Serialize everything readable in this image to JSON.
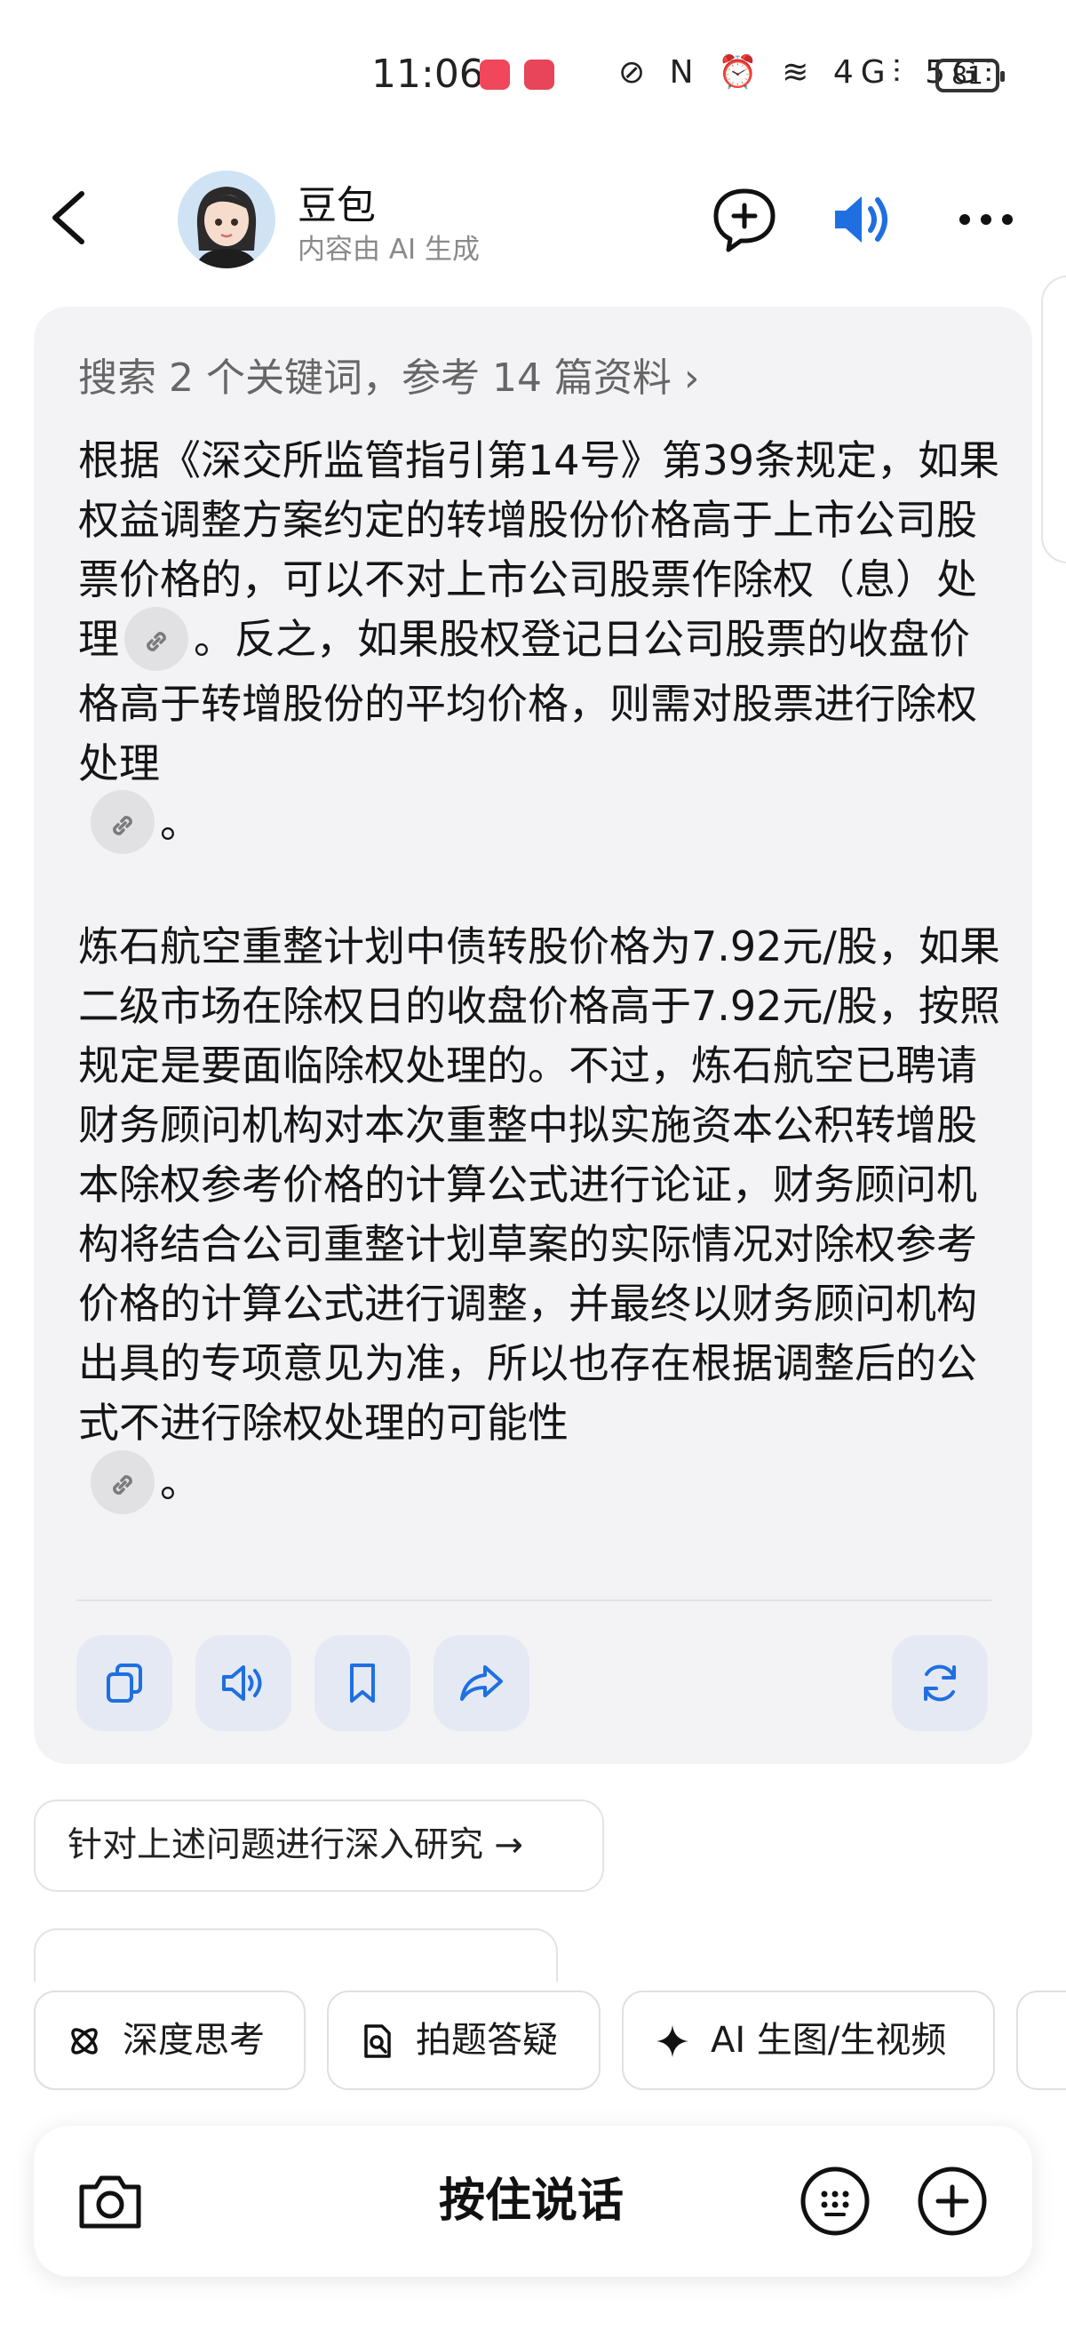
{
  "status": {
    "time": "11:06",
    "network_icons": [
      "speed-icon",
      "nfc-icon",
      "alarm-icon",
      "wifi-icon",
      "4g-signal-icon",
      "5g-signal-icon"
    ],
    "network_text": "⊘ N ⏰ ≋ 4G⫶ 5G⫶",
    "battery": "81"
  },
  "header": {
    "name": "豆包",
    "subtitle": "内容由 AI 生成"
  },
  "card": {
    "search_summary": "搜索 2 个关键词，参考 14 篇资料 ›",
    "para1_a": "根据《深交所监管指引第14号》第39条规定，如果权益调整方案约定的转增股份价格高于上市公司股票价格的，可以不对上市公司股票作除权（息）处理",
    "para1_b": "。反之，如果股权登记日公司股票的收盘价格高于转增股份的平均价格，则需对股票进行除权处理",
    "para1_c": "。",
    "para2_a": "炼石航空重整计划中债转股价格为7.92元/股，如果二级市场在除权日的收盘价格高于7.92元/股，按照规定是要面临除权处理的。不过，炼石航空已聘请财务顾问机构对本次重整中拟实施资本公积转增股本除权参考价格的计算公式进行论证，财务顾问机构将结合公司重整计划草案的实际情况对除权参考价格的计算公式进行调整，并最终以财务顾问机构出具的专项意见为准，所以也存在根据调整后的公式不进行除权处理的可能性",
    "para2_b": "。"
  },
  "suggestion": "针对上述问题进行深入研究 →",
  "chips": [
    {
      "label": "深度思考",
      "icon": "deep-think-icon"
    },
    {
      "label": "拍题答疑",
      "icon": "photo-question-icon"
    },
    {
      "label": "AI 生图/生视频",
      "icon": "sparkle-icon"
    }
  ],
  "input": {
    "hold_to_talk": "按住说话"
  },
  "colors": {
    "accent": "#1f6fe0",
    "card_bg": "#f3f3f5",
    "action_btn_bg": "#e4e9f3"
  }
}
